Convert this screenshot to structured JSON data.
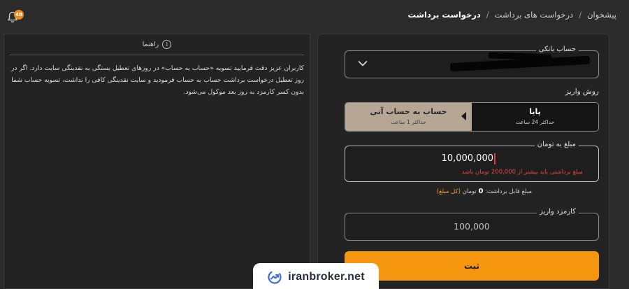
{
  "breadcrumb": {
    "items": [
      "پیشخوان",
      "درخواست های برداشت"
    ],
    "current": "درخواست برداشت",
    "separator": "/"
  },
  "notifications": {
    "icon": "bell-icon",
    "count": "48"
  },
  "guide": {
    "title": "راهنما",
    "text": "کاربران عزیز دقت فرمایید تسویه «حساب به حساب» در روزهای تعطیل بستگی به نقدینگی سایت دارد. اگر در روز تعطیل درخواست برداشت حساب به حساب فرمودید و سایت نقدینگی کافی را نداشت، تسویه حساب شما بدون کسر کارمزد به روز بعد موکول می‌شود."
  },
  "form": {
    "bank_account_label": "حساب بانکی",
    "deposit_method_label": "روش واریز",
    "methods": [
      {
        "title": "پایا",
        "subtitle": "حداکثر 24 ساعت",
        "selected": false
      },
      {
        "title": "حساب به حساب آنی",
        "subtitle": "حداکثر 1 ساعت",
        "selected": true
      }
    ],
    "amount_label": "مبلغ به تومان",
    "amount_value": "10,000,000",
    "amount_error": "مبلغ برداشتی باید بیشتر از 200,000 تومان باشد",
    "balance_prefix": "مبلغ قابل برداشت:",
    "balance_value": "0",
    "balance_unit": "تومان",
    "balance_link": "(کل مبلغ)",
    "fee_label": "کارمزد واریز",
    "fee_value": "100,000",
    "submit_label": "ثبت"
  },
  "watermark": {
    "text": "iranbroker.net"
  },
  "colors": {
    "background": "#2b2b2b",
    "panel": "#232323",
    "accent": "#f6950e",
    "selected_method": "#b6a795",
    "error": "#e54848"
  }
}
